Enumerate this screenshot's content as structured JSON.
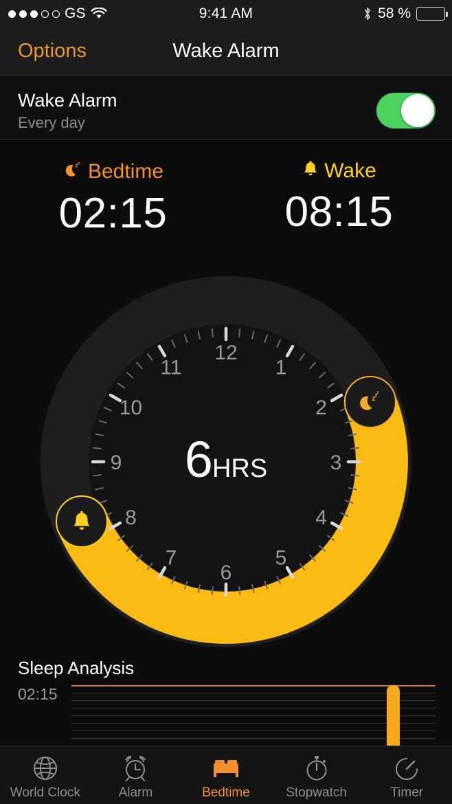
{
  "statusbar": {
    "signal_filled": 3,
    "signal_total": 5,
    "carrier": "GS",
    "wifi_icon": "wifi-icon",
    "time": "9:41 AM",
    "bluetooth_icon": "bluetooth-icon",
    "battery_percent": "58 %",
    "battery_level": 58
  },
  "navbar": {
    "left_button": "Options",
    "title": "Wake Alarm"
  },
  "alarm_row": {
    "title": "Wake Alarm",
    "subtitle": "Every day",
    "toggle_on": true,
    "toggle_color": "#4cd35f"
  },
  "times": {
    "bedtime": {
      "label": "Bedtime",
      "value": "02:15",
      "icon": "moon-zzz-icon",
      "color": "#f2912e"
    },
    "wake": {
      "label": "Wake",
      "value": "08:15",
      "icon": "bell-icon",
      "color": "#fdd11c"
    }
  },
  "dial": {
    "duration_number": "6",
    "duration_unit": "HRS",
    "hours": [
      "12",
      "1",
      "2",
      "3",
      "4",
      "5",
      "6",
      "7",
      "8",
      "9",
      "10",
      "11"
    ],
    "bedtime_hour": 2.25,
    "wake_hour": 8.25,
    "arc_color": "#fcbb13",
    "track_color": "#1e1e1e",
    "face_color": "#131313",
    "bedtime_handle_icon": "moon-zzz-icon",
    "wake_handle_icon": "bell-icon"
  },
  "analysis": {
    "title": "Sleep Analysis",
    "axis_label": "02:15"
  },
  "chart_data": {
    "type": "bar",
    "title": "Sleep Analysis",
    "categories": [
      "",
      "",
      "",
      "",
      "",
      "",
      "",
      "",
      "",
      "",
      "",
      "",
      "",
      "",
      "",
      "",
      "",
      "",
      "",
      "",
      "",
      "",
      "",
      "",
      "",
      "",
      "",
      "",
      ""
    ],
    "values": [
      0,
      0,
      0,
      0,
      0,
      0,
      0,
      0,
      0,
      0,
      0,
      0,
      0,
      0,
      0,
      0,
      0,
      0,
      0,
      0,
      0,
      0,
      0,
      0,
      0,
      100,
      0,
      0,
      0
    ],
    "bar_index": 25,
    "bar_value": 100,
    "ylabel": "02:15",
    "xlabel": "",
    "ylim": [
      0,
      100
    ],
    "grid": true,
    "gridline_count": 8,
    "top_gridline_color": "#c87a2a",
    "gridline_color": "#333333",
    "bar_color": "#f9a91b",
    "legend": []
  },
  "tabbar": {
    "items": [
      {
        "label": "World Clock",
        "icon": "globe-icon",
        "active": false
      },
      {
        "label": "Alarm",
        "icon": "alarm-clock-icon",
        "active": false
      },
      {
        "label": "Bedtime",
        "icon": "bed-icon",
        "active": true
      },
      {
        "label": "Stopwatch",
        "icon": "stopwatch-icon",
        "active": false
      },
      {
        "label": "Timer",
        "icon": "timer-icon",
        "active": false
      }
    ],
    "active_color": "#f2912e",
    "inactive_color": "#8e8e8e"
  }
}
